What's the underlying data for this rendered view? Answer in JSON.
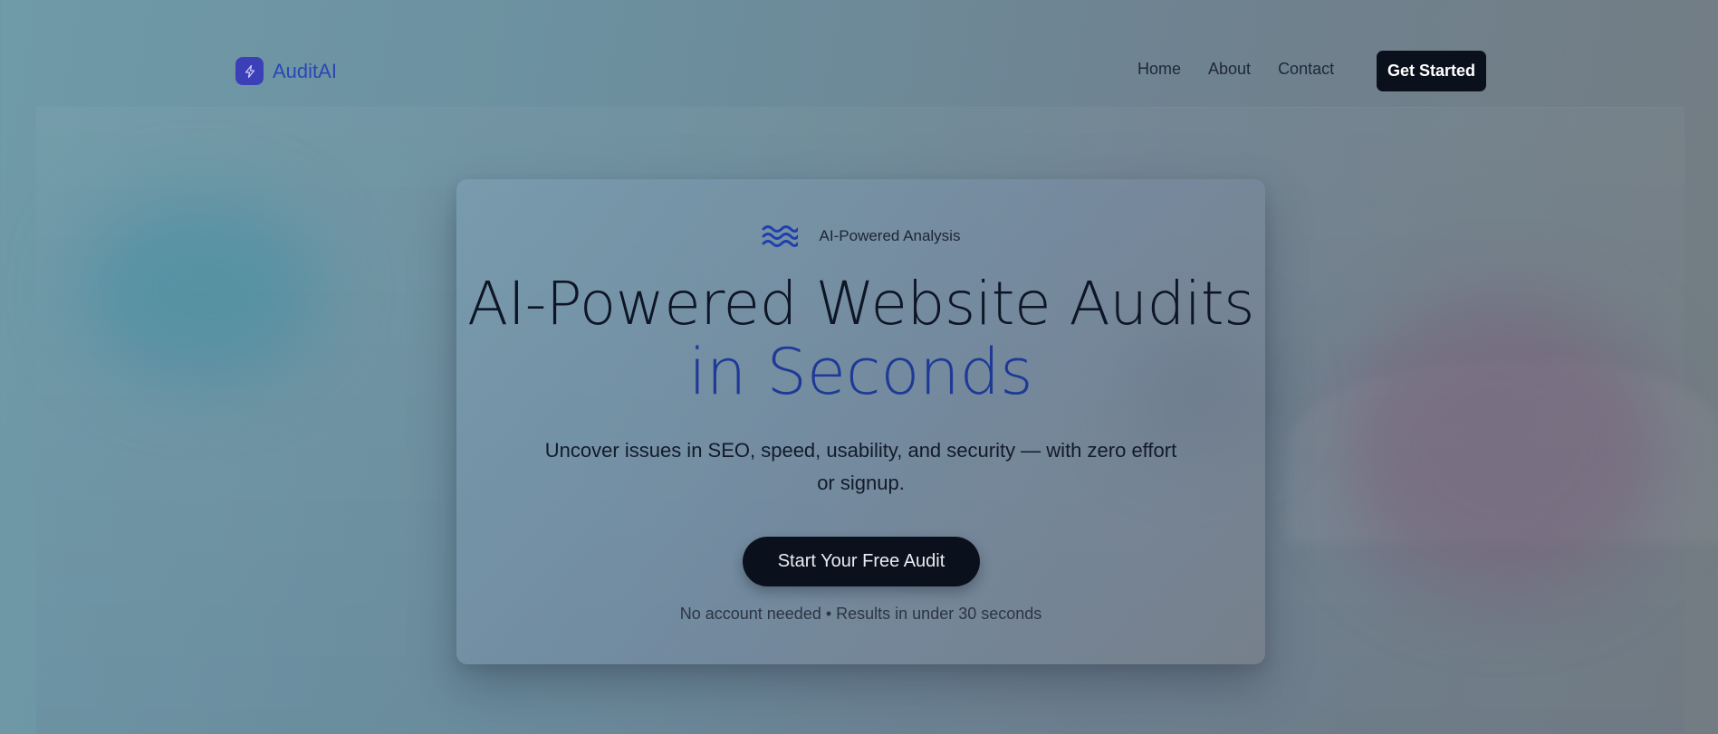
{
  "header": {
    "brand_name": "AuditAI",
    "nav": [
      "Home",
      "About",
      "Contact"
    ],
    "cta_label": "Get Started"
  },
  "hero": {
    "badge_text": "AI-Powered Analysis",
    "headline_line1": "AI-Powered Website Audits",
    "headline_line2": "in Seconds",
    "subtitle": "Uncover issues in SEO, speed, usability, and security — with zero effort or signup.",
    "cta_label": "Start Your Free Audit",
    "note": "No account needed • Results in under 30 seconds"
  },
  "colors": {
    "brand_blue": "#2a46b8",
    "logo_bg": "#3b3fb8",
    "dark_button": "#0b111c",
    "headline_accent": "#1e3a96"
  },
  "icons": {
    "brand": "lightning-icon",
    "badge": "waves-icon"
  }
}
